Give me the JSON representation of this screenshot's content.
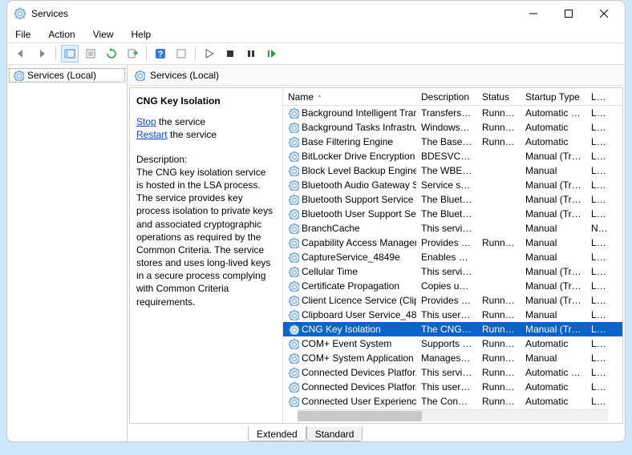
{
  "window": {
    "title": "Services"
  },
  "menu": {
    "file": "File",
    "action": "Action",
    "view": "View",
    "help": "Help"
  },
  "tree": {
    "root": "Services (Local)"
  },
  "content_header": "Services (Local)",
  "detail": {
    "title": "CNG Key Isolation",
    "stop_link": "Stop",
    "stop_suffix": " the service",
    "restart_link": "Restart",
    "restart_suffix": " the service",
    "desc_label": "Description:",
    "desc_text": "The CNG key isolation service is hosted in the LSA process. The service provides key process isolation to private keys and associated cryptographic operations as required by the Common Criteria. The service stores and uses long-lived keys in a secure process complying with Common Criteria requirements."
  },
  "columns": {
    "name": "Name",
    "description": "Description",
    "status": "Status",
    "startup": "Startup Type",
    "logon": "Log"
  },
  "rows": [
    {
      "name": "Background Intelligent Tran...",
      "desc": "Transfers fil...",
      "status": "Running",
      "startup": "Automatic (...",
      "logon": "Loc"
    },
    {
      "name": "Background Tasks Infrastruc...",
      "desc": "Windows in...",
      "status": "Running",
      "startup": "Automatic",
      "logon": "Loc"
    },
    {
      "name": "Base Filtering Engine",
      "desc": "The Base Fil...",
      "status": "Running",
      "startup": "Automatic",
      "logon": "Loc"
    },
    {
      "name": "BitLocker Drive Encryption ...",
      "desc": "BDESVC hos...",
      "status": "",
      "startup": "Manual (Trig...",
      "logon": "Loc"
    },
    {
      "name": "Block Level Backup Engine ...",
      "desc": "The WBENG...",
      "status": "",
      "startup": "Manual",
      "logon": "Loc"
    },
    {
      "name": "Bluetooth Audio Gateway S...",
      "desc": "Service sup...",
      "status": "",
      "startup": "Manual (Trig...",
      "logon": "Loc"
    },
    {
      "name": "Bluetooth Support Service",
      "desc": "The Bluetoo...",
      "status": "",
      "startup": "Manual (Trig...",
      "logon": "Loc"
    },
    {
      "name": "Bluetooth User Support Ser...",
      "desc": "The Bluetoo...",
      "status": "",
      "startup": "Manual (Trig...",
      "logon": "Loc"
    },
    {
      "name": "BranchCache",
      "desc": "This service ...",
      "status": "",
      "startup": "Manual",
      "logon": "Net"
    },
    {
      "name": "Capability Access Manager ...",
      "desc": "Provides fac...",
      "status": "Running",
      "startup": "Manual",
      "logon": "Loc"
    },
    {
      "name": "CaptureService_4849e",
      "desc": "Enables opti...",
      "status": "",
      "startup": "Manual",
      "logon": "Loc"
    },
    {
      "name": "Cellular Time",
      "desc": "This service ...",
      "status": "",
      "startup": "Manual (Trig...",
      "logon": "Loc"
    },
    {
      "name": "Certificate Propagation",
      "desc": "Copies user ...",
      "status": "",
      "startup": "Manual (Trig...",
      "logon": "Loc"
    },
    {
      "name": "Client Licence Service (Clip...",
      "desc": "Provides inf...",
      "status": "Running",
      "startup": "Manual (Trig...",
      "logon": "Loc"
    },
    {
      "name": "Clipboard User Service_4849e",
      "desc": "This user ser...",
      "status": "Running",
      "startup": "Manual",
      "logon": "Loc"
    },
    {
      "name": "CNG Key Isolation",
      "desc": "The CNG ke...",
      "status": "Running",
      "startup": "Manual (Trig...",
      "logon": "Loc",
      "selected": true
    },
    {
      "name": "COM+ Event System",
      "desc": "Supports Sy...",
      "status": "Running",
      "startup": "Automatic",
      "logon": "Loc"
    },
    {
      "name": "COM+ System Application",
      "desc": "Manages th...",
      "status": "Running",
      "startup": "Manual",
      "logon": "Loc"
    },
    {
      "name": "Connected Devices Platfor...",
      "desc": "This service ...",
      "status": "Running",
      "startup": "Automatic (...",
      "logon": "Loc"
    },
    {
      "name": "Connected Devices Platfor...",
      "desc": "This user ser...",
      "status": "Running",
      "startup": "Automatic",
      "logon": "Loc"
    },
    {
      "name": "Connected User Experience...",
      "desc": "The Connec...",
      "status": "Running",
      "startup": "Automatic",
      "logon": "Loc"
    }
  ],
  "tabs": {
    "extended": "Extended",
    "standard": "Standard"
  }
}
